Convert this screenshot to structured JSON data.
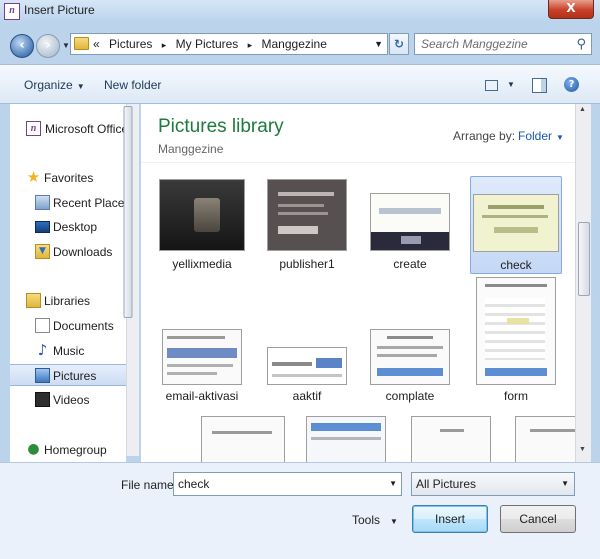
{
  "window": {
    "title": "Insert Picture",
    "close_glyph": "X"
  },
  "address": {
    "chevron": "«",
    "crumbs": [
      "Pictures",
      "My Pictures",
      "Manggezine"
    ],
    "separator": "▸"
  },
  "search": {
    "placeholder": "Search Manggezine"
  },
  "toolbar": {
    "organize_label": "Organize",
    "new_folder_label": "New folder"
  },
  "sidebar": {
    "items": [
      {
        "label": "Microsoft Office C",
        "icon": "office-icon"
      },
      {
        "label": "Favorites",
        "icon": "star-icon"
      },
      {
        "label": "Recent Places",
        "icon": "recent-places-icon"
      },
      {
        "label": "Desktop",
        "icon": "desktop-icon"
      },
      {
        "label": "Downloads",
        "icon": "downloads-icon"
      },
      {
        "label": "Libraries",
        "icon": "libraries-icon"
      },
      {
        "label": "Documents",
        "icon": "documents-icon"
      },
      {
        "label": "Music",
        "icon": "music-icon"
      },
      {
        "label": "Pictures",
        "icon": "pictures-icon",
        "selected": true
      },
      {
        "label": "Videos",
        "icon": "videos-icon"
      },
      {
        "label": "Homegroup",
        "icon": "homegroup-icon"
      }
    ]
  },
  "library": {
    "title": "Pictures library",
    "subtitle": "Manggezine",
    "arrange_label": "Arrange by:",
    "arrange_value": "Folder"
  },
  "files": [
    {
      "name": "yellixmedia",
      "selected": false
    },
    {
      "name": "publisher1",
      "selected": false
    },
    {
      "name": "create",
      "selected": false
    },
    {
      "name": "check",
      "selected": true
    },
    {
      "name": "email-aktivasi",
      "selected": false
    },
    {
      "name": "aaktif",
      "selected": false
    },
    {
      "name": "complate",
      "selected": false
    },
    {
      "name": "form",
      "selected": false
    }
  ],
  "footer": {
    "filename_label": "File name:",
    "filename_value": "check",
    "filter_value": "All Pictures",
    "tools_label": "Tools",
    "insert_label": "Insert",
    "cancel_label": "Cancel"
  }
}
